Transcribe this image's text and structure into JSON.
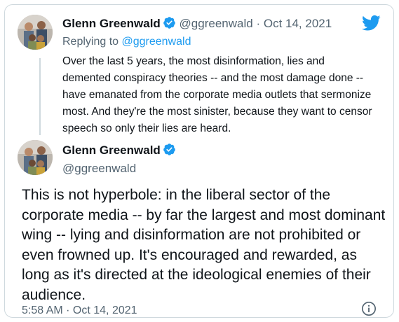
{
  "parent_tweet": {
    "author_name": "Glenn Greenwald",
    "handle": "@ggreenwald",
    "separator": "·",
    "date": "Oct 14, 2021",
    "replying_prefix": "Replying to",
    "replying_to": "@ggreenwald",
    "text": "Over the last 5 years, the most disinformation, lies and demented conspiracy theories -- and the most damage done -- have emanated from the corporate media outlets that sermonize most. And they're the most sinister, because they want to censor speech so only their lies are heard."
  },
  "main_tweet": {
    "author_name": "Glenn Greenwald",
    "handle": "@ggreenwald",
    "text": "This is not hyperbole: in the liberal sector of the corporate media -- by far the largest and most dominant wing -- lying and disinformation are not prohibited or even frowned up. It's encouraged and rewarded, as long as it's directed at the ideological enemies of their audience.",
    "timestamp": "5:58 AM · Oct 14, 2021"
  },
  "icons": {
    "brand": "twitter-bird-icon",
    "verified": "verified-badge-icon",
    "info": "info-icon"
  },
  "colors": {
    "accent": "#1d9bf0",
    "text": "#0f1419",
    "muted": "#536471",
    "border": "#cfd9de"
  }
}
